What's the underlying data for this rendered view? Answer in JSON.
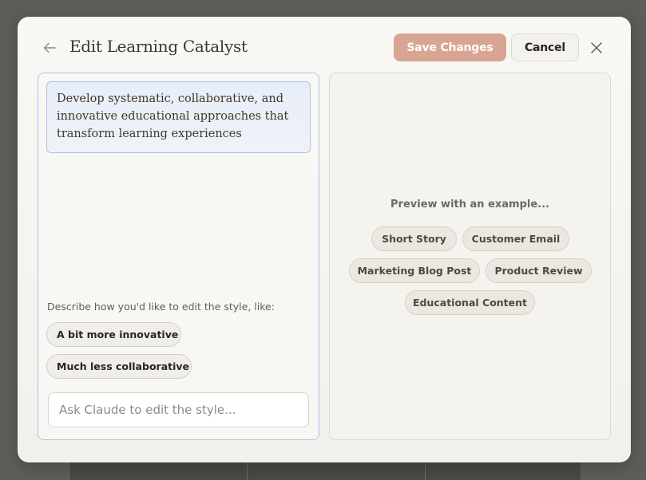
{
  "dialog": {
    "title": "Edit Learning Catalyst",
    "save_label": "Save Changes",
    "cancel_label": "Cancel"
  },
  "editor": {
    "description": "Develop systematic, collaborative, and innovative educational approaches that transform learning experiences",
    "hint": "Describe how you'd like to edit the style, like:",
    "suggestions": [
      "A bit more innovative",
      "Much less collaborative"
    ],
    "input_placeholder": "Ask Claude to edit the style..."
  },
  "preview": {
    "title": "Preview with an example...",
    "examples": [
      "Short Story",
      "Customer Email",
      "Marketing Blog Post",
      "Product Review",
      "Educational Content"
    ]
  },
  "colors": {
    "save_button": "#d9a593",
    "active_border": "#a9c3e6",
    "backdrop": "#5e5d59"
  },
  "icons": {
    "back": "arrow-left-icon",
    "close": "close-icon"
  }
}
